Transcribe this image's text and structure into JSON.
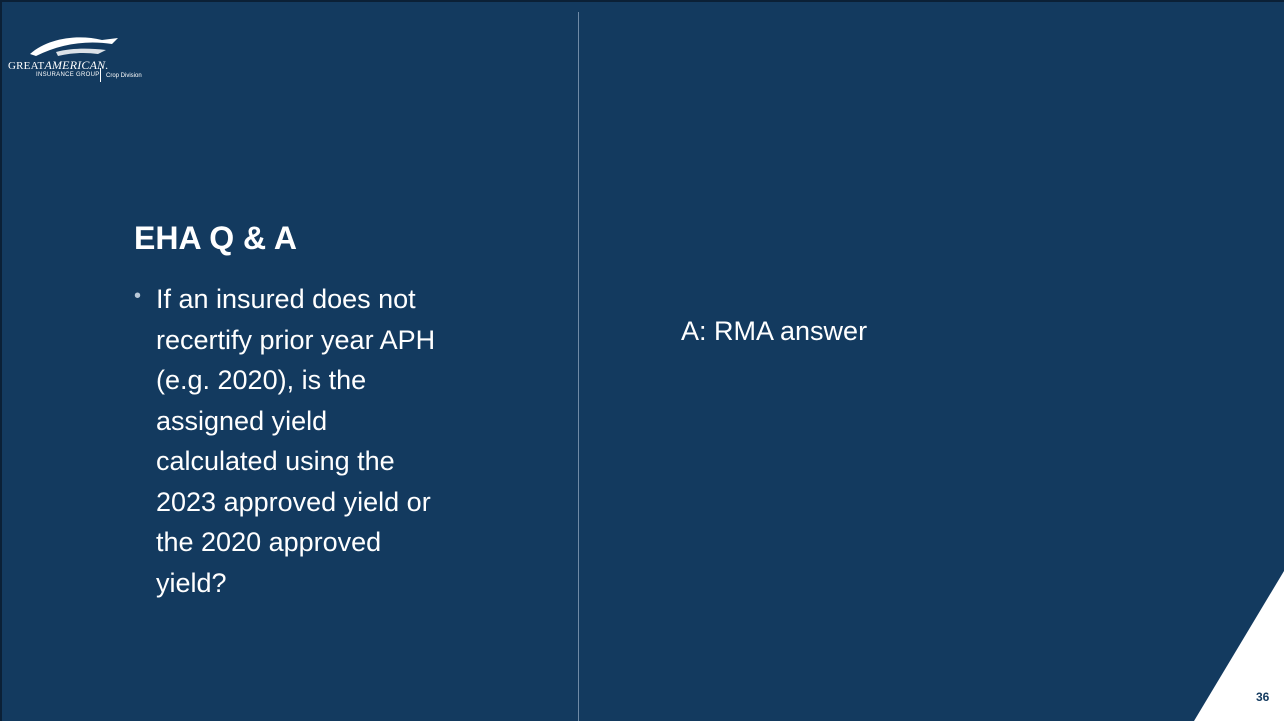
{
  "logo": {
    "brand_line1_prefix": "GREAT",
    "brand_line1_suffix": "AMERICAN.",
    "brand_line2": "INSURANCE GROUP",
    "division": "Crop Division"
  },
  "slide": {
    "title": "EHA Q & A",
    "bullet": {
      "marker": "•",
      "lines": [
        "If an insured does not",
        "recertify prior year APH",
        "(e.g. 2020), is the",
        "assigned yield",
        "calculated using the",
        "2023 approved yield or",
        "the 2020 approved",
        "yield?"
      ]
    },
    "answer": "A:  RMA answer",
    "page_number": "36"
  },
  "colors": {
    "background": "#133a5f",
    "corner": "#ffffff",
    "text": "#ffffff"
  },
  "icons": {
    "logo_mark": "eagle-icon"
  }
}
